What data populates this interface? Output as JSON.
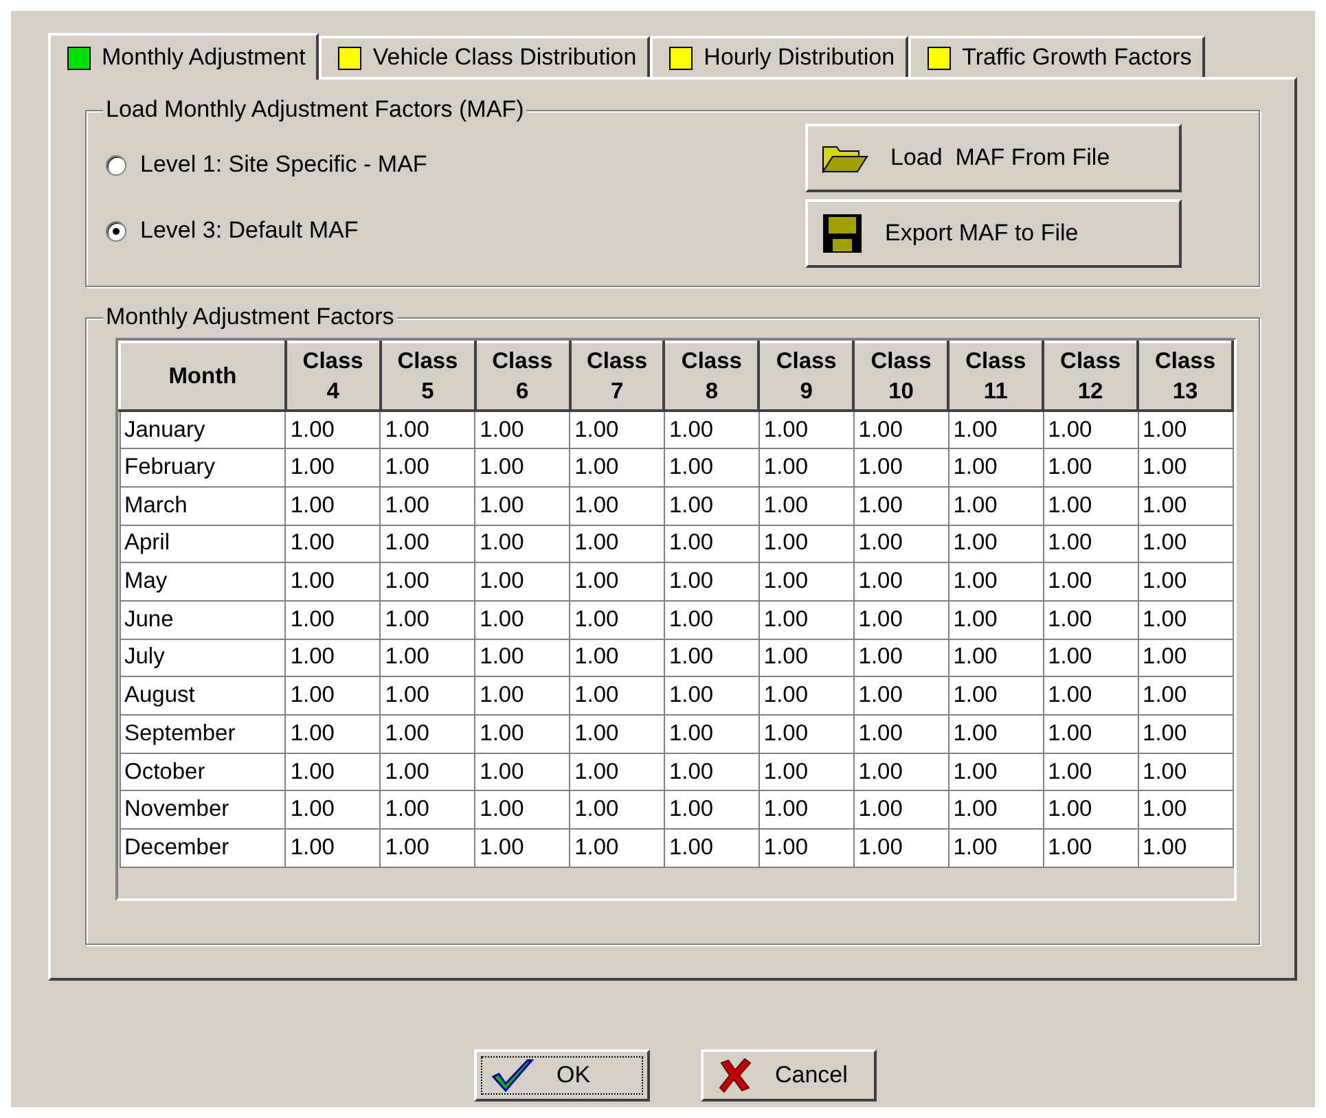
{
  "tabs": [
    {
      "label": "Monthly Adjustment",
      "selected": true,
      "color": "#00e000"
    },
    {
      "label": "Vehicle Class Distribution",
      "selected": false,
      "color": "#ffff00"
    },
    {
      "label": "Hourly Distribution",
      "selected": false,
      "color": "#ffff00"
    },
    {
      "label": "Traffic Growth Factors",
      "selected": false,
      "color": "#ffff00"
    }
  ],
  "load_group": {
    "title": "Load Monthly Adjustment Factors (MAF)",
    "options": [
      {
        "label": "Level 1: Site Specific - MAF",
        "selected": false
      },
      {
        "label": "Level 3: Default MAF",
        "selected": true
      }
    ],
    "buttons": [
      {
        "label": "Load  MAF From File",
        "kind": "open"
      },
      {
        "label": "Export MAF to File",
        "kind": "save"
      }
    ]
  },
  "factors_group": {
    "title": "Monthly Adjustment Factors",
    "columns": [
      "Month",
      "Class 4",
      "Class 5",
      "Class 6",
      "Class 7",
      "Class 8",
      "Class 9",
      "Class 10",
      "Class 11",
      "Class 12",
      "Class 13"
    ],
    "rows": [
      {
        "month": "January",
        "values": [
          "1.00",
          "1.00",
          "1.00",
          "1.00",
          "1.00",
          "1.00",
          "1.00",
          "1.00",
          "1.00",
          "1.00"
        ]
      },
      {
        "month": "February",
        "values": [
          "1.00",
          "1.00",
          "1.00",
          "1.00",
          "1.00",
          "1.00",
          "1.00",
          "1.00",
          "1.00",
          "1.00"
        ]
      },
      {
        "month": "March",
        "values": [
          "1.00",
          "1.00",
          "1.00",
          "1.00",
          "1.00",
          "1.00",
          "1.00",
          "1.00",
          "1.00",
          "1.00"
        ]
      },
      {
        "month": "April",
        "values": [
          "1.00",
          "1.00",
          "1.00",
          "1.00",
          "1.00",
          "1.00",
          "1.00",
          "1.00",
          "1.00",
          "1.00"
        ]
      },
      {
        "month": "May",
        "values": [
          "1.00",
          "1.00",
          "1.00",
          "1.00",
          "1.00",
          "1.00",
          "1.00",
          "1.00",
          "1.00",
          "1.00"
        ]
      },
      {
        "month": "June",
        "values": [
          "1.00",
          "1.00",
          "1.00",
          "1.00",
          "1.00",
          "1.00",
          "1.00",
          "1.00",
          "1.00",
          "1.00"
        ]
      },
      {
        "month": "July",
        "values": [
          "1.00",
          "1.00",
          "1.00",
          "1.00",
          "1.00",
          "1.00",
          "1.00",
          "1.00",
          "1.00",
          "1.00"
        ]
      },
      {
        "month": "August",
        "values": [
          "1.00",
          "1.00",
          "1.00",
          "1.00",
          "1.00",
          "1.00",
          "1.00",
          "1.00",
          "1.00",
          "1.00"
        ]
      },
      {
        "month": "September",
        "values": [
          "1.00",
          "1.00",
          "1.00",
          "1.00",
          "1.00",
          "1.00",
          "1.00",
          "1.00",
          "1.00",
          "1.00"
        ]
      },
      {
        "month": "October",
        "values": [
          "1.00",
          "1.00",
          "1.00",
          "1.00",
          "1.00",
          "1.00",
          "1.00",
          "1.00",
          "1.00",
          "1.00"
        ]
      },
      {
        "month": "November",
        "values": [
          "1.00",
          "1.00",
          "1.00",
          "1.00",
          "1.00",
          "1.00",
          "1.00",
          "1.00",
          "1.00",
          "1.00"
        ]
      },
      {
        "month": "December",
        "values": [
          "1.00",
          "1.00",
          "1.00",
          "1.00",
          "1.00",
          "1.00",
          "1.00",
          "1.00",
          "1.00",
          "1.00"
        ]
      }
    ]
  },
  "dialog_buttons": [
    {
      "label": "OK",
      "kind": "ok",
      "focused": true
    },
    {
      "label": "Cancel",
      "kind": "cancel",
      "focused": false
    }
  ]
}
